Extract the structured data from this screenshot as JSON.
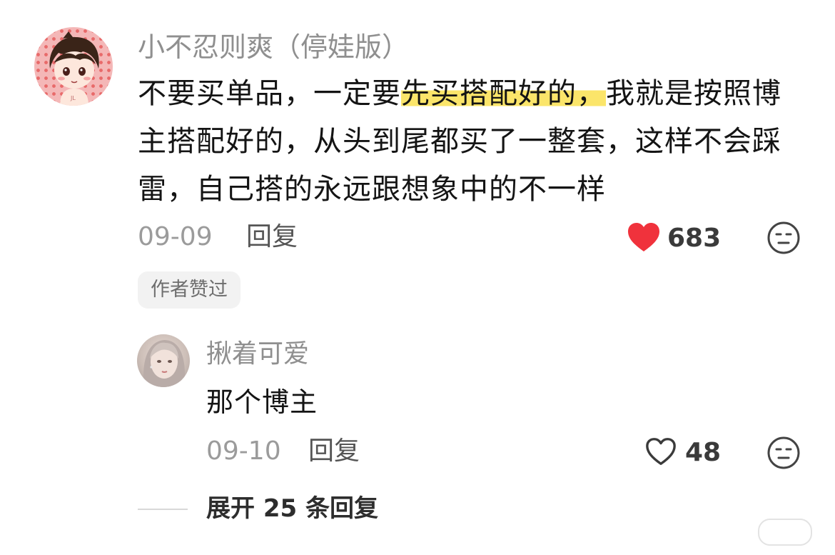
{
  "comment": {
    "username": "小不忍则爽（停娃版）",
    "text_before": "不要买单品，一定要",
    "text_highlight": "先买搭配好的，",
    "text_after": "我就是按照博主搭配好的，从头到尾都买了一整套，这样不会踩雷，自己搭的永远跟想象中的不一样",
    "date": "09-09",
    "reply_label": "回复",
    "like_count": "683",
    "liked": true,
    "author_badge": "作者赞过"
  },
  "reply": {
    "username": "揪着可爱",
    "text": "那个博主",
    "date": "09-10",
    "reply_label": "回复",
    "like_count": "48",
    "liked": false
  },
  "expand": {
    "label": "展开 25 条回复"
  },
  "colors": {
    "highlight": "#fbe56a",
    "like_active": "#f0323c",
    "username": "#8f8f8f"
  },
  "icons": {
    "like_main": "heart-filled-icon",
    "like_reply": "heart-outline-icon",
    "dislike": "neutral-face-icon"
  }
}
